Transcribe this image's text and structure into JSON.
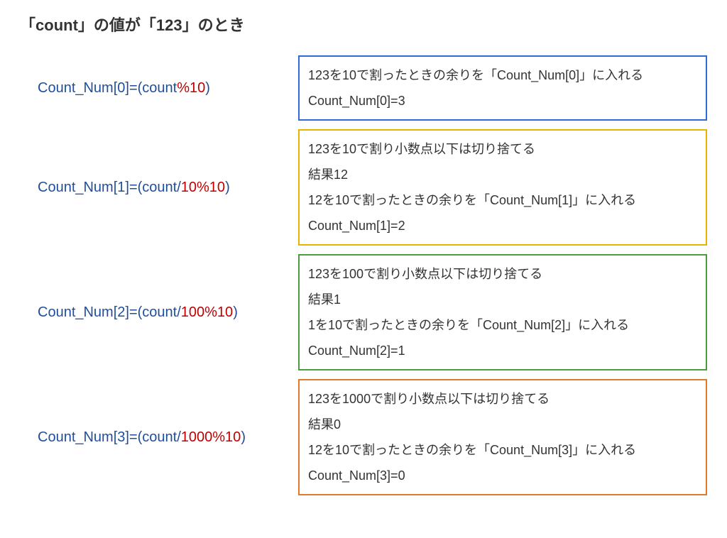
{
  "title_parts": {
    "p1": "「",
    "p2": "count",
    "p3": "」の値が「",
    "p4": "123",
    "p5": "」のとき"
  },
  "rows": [
    {
      "formula": {
        "pre": "Count_Num[0]=(count",
        "mid": "%10",
        "post": ")"
      },
      "lines": [
        "123を10で割ったときの余りを「Count_Num[0]」に入れる",
        "Count_Num[0]=3"
      ]
    },
    {
      "formula": {
        "pre": "Count_Num[1]=(count/",
        "mid": "10%10",
        "post": ")"
      },
      "lines": [
        "123を10で割り小数点以下は切り捨てる",
        "結果12",
        "12を10で割ったときの余りを「Count_Num[1]」に入れる",
        "Count_Num[1]=2"
      ]
    },
    {
      "formula": {
        "pre": "Count_Num[2]=(count/",
        "mid": "100%10",
        "post": ")"
      },
      "lines": [
        "123を100で割り小数点以下は切り捨てる",
        "結果1",
        "1を10で割ったときの余りを「Count_Num[2]」に入れる",
        "Count_Num[2]=1"
      ]
    },
    {
      "formula": {
        "pre": "Count_Num[3]=(count/",
        "mid": "1000%10",
        "post": ")"
      },
      "lines": [
        "123を1000で割り小数点以下は切り捨てる",
        "結果0",
        "12を10で割ったときの余りを「Count_Num[3]」に入れる",
        "Count_Num[3]=0"
      ]
    }
  ],
  "border_colors": [
    "b-blue",
    "b-yellow",
    "b-green",
    "b-orange"
  ]
}
